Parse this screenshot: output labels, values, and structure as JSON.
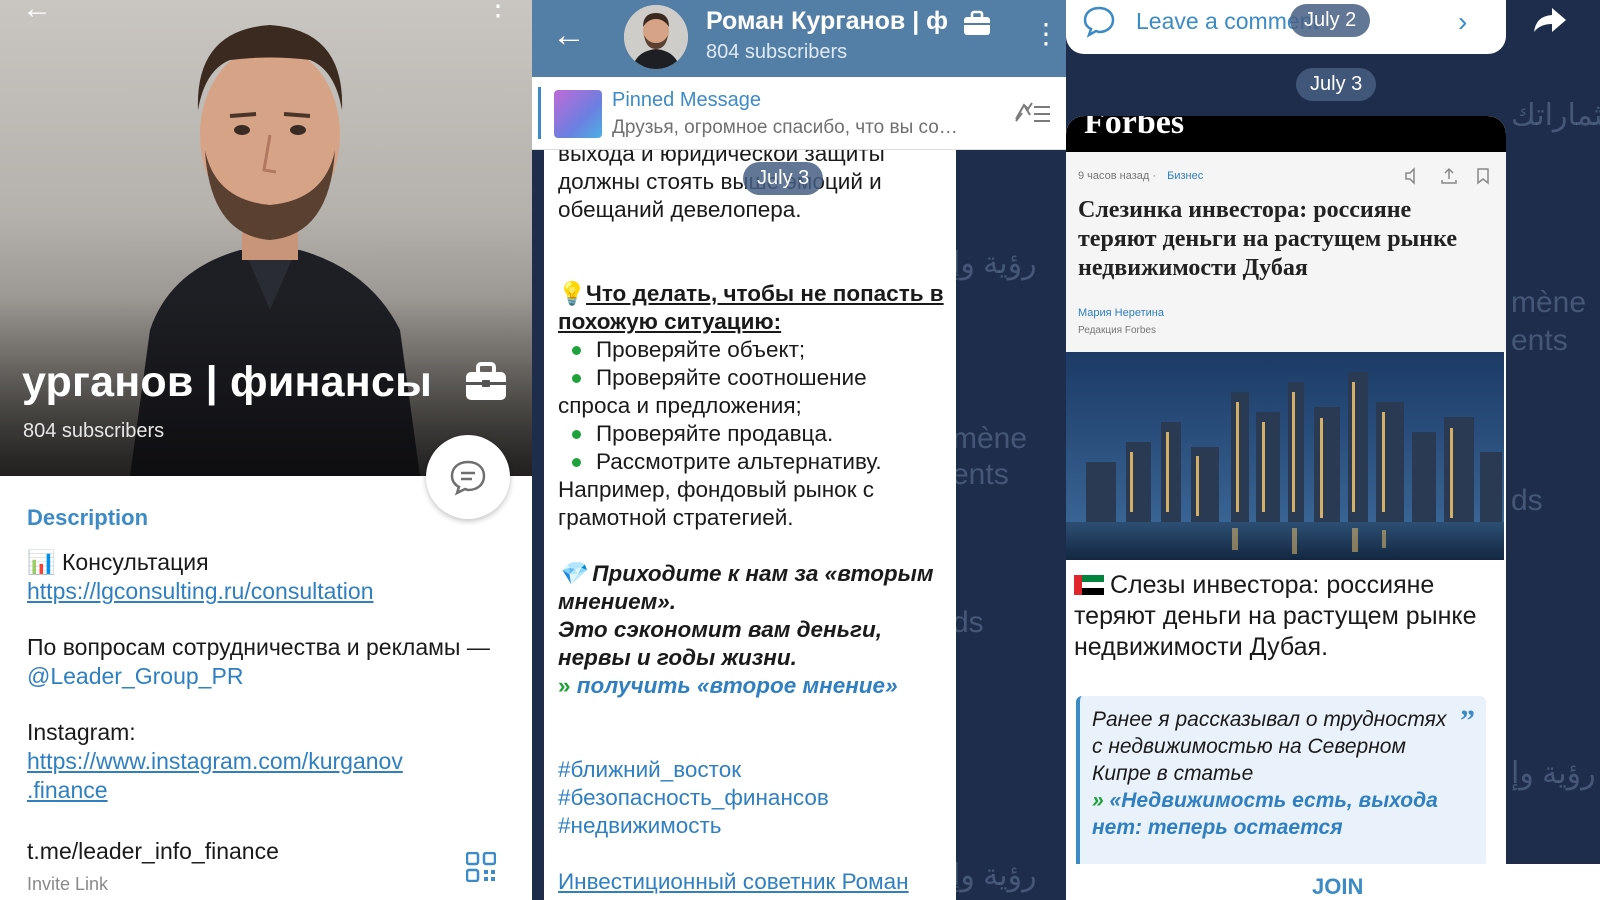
{
  "profile": {
    "title": "урганов | финансы",
    "subscribers": "804 subscribers",
    "description_label": "Description",
    "consult_label": "📊 Консультация",
    "consult_link": "https://lgconsulting.ru/consultation",
    "coop_text": "По вопросам сотрудничества и рекламы —",
    "coop_mention": "@Leader_Group_PR",
    "instagram_label": "Instagram:",
    "instagram_link_1": "https://www.instagram.com/kurganov",
    "instagram_link_2": ".finance",
    "invite_link": "t.me/leader_info_finance",
    "invite_label": "Invite Link"
  },
  "chat": {
    "title": "Роман Курганов | ф",
    "subscribers": "804 subscribers",
    "pinned_title": "Pinned Message",
    "pinned_text": "Друзья, огромное спасибо, что вы со…",
    "date_pill": "July 3",
    "msg_line_1": "выхода и юридической защиты",
    "msg_line_2": "должны стоять выше эмоций и",
    "msg_line_3": "обещаний девелопера.",
    "tip_heading": "Что делать, чтобы не попасть в похожую ситуацию:",
    "tips": [
      "Проверяйте объект;",
      "Проверяйте соотношение",
      "Проверяйте продавца.",
      "Рассмотрите альтернативу."
    ],
    "tip_cont": "спроса и предложения;",
    "alt_text": "Например, фондовый рынок с грамотной стратегией.",
    "cta_line": "Приходите к нам за «вторым мнением».",
    "cta_line_2": "Это сэкономит вам деньги, нервы и годы жизни.",
    "cta_link": "получить «второе мнение»",
    "tags": [
      "#ближний_восток",
      "#безопасность_финансов",
      "#недвижимость"
    ],
    "signature": "Инвестиционный советник Роман"
  },
  "post": {
    "comment_label": "Leave a comment",
    "date_pill_top": "July 2",
    "date_pill": "July 3",
    "forbes_logo": "Forbes",
    "article_meta": "9 часов назад",
    "article_category": "Бизнес",
    "article_title": "Слезинка инвестора: россияне теряют деньги на растущем рынке недвижимости Дубая",
    "article_author": "Мария Неретина",
    "article_role": "Редакция Forbes",
    "title": "Слезы инвестора: россияне теряют деньги на растущем рынке недвижимости Дубая.",
    "quote_text": "Ранее я рассказывал о трудностях с недвижимостью на Северном Кипре в статье",
    "quote_link": "«Недвижимость есть, выхода нет: теперь остается",
    "join": "JOIN"
  },
  "background": {
    "arabic": "رؤية وإ",
    "arabic_2": "رؤية واضحة لاستثماراتك",
    "french_1": "mène",
    "french_2": "ents",
    "fr_ds": "ds"
  }
}
